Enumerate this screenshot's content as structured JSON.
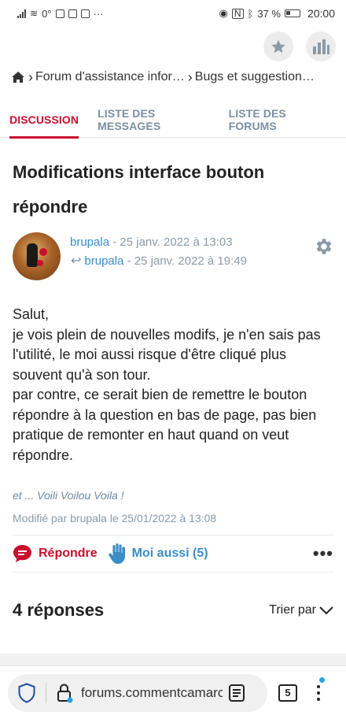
{
  "statusbar": {
    "temperature": "0°",
    "more_dots": "···",
    "battery_percent": "37 %",
    "time": "20:00"
  },
  "breadcrumb": {
    "items": [
      "Forum d'assistance infor…",
      "Bugs et suggestion…"
    ]
  },
  "tabs": [
    {
      "label": "DISCUSSION",
      "active": true
    },
    {
      "label": "LISTE DES MESSAGES",
      "active": false
    },
    {
      "label": "LISTE DES FORUMS",
      "active": false
    }
  ],
  "post": {
    "title": "Modifications interface bouton répondre",
    "author": "brupala",
    "date": "- 25 janv. 2022 à 13:03",
    "reply_author": "brupala",
    "reply_date": "- 25 janv. 2022 à 19:49",
    "body": [
      "Salut,",
      "je vois plein de nouvelles modifs, je n'en sais pas l'utilité, le moi aussi risque d'être cliqué plus souvent qu'à son tour.",
      "par contre, ce serait bien de remettre le bouton répondre à la question en bas de page, pas bien pratique de remonter en haut quand on veut répondre."
    ],
    "signature": "et ... Voili  Voilou  Voila !",
    "modified": "Modifié par brupala le 25/01/2022 à 13:08"
  },
  "actions": {
    "reply_label": "Répondre",
    "metoo_label": "Moi aussi (5)",
    "more_label": "•••"
  },
  "answers": {
    "count_label": "4 réponses",
    "sort_label": "Trier par"
  },
  "browser": {
    "url": "forums.commentcamarche.net",
    "tab_count": "5"
  },
  "colors": {
    "accent_red": "#c8102e",
    "link_blue": "#3a8dc5",
    "muted": "#8a9aa8",
    "notification": "#22a5e8"
  }
}
